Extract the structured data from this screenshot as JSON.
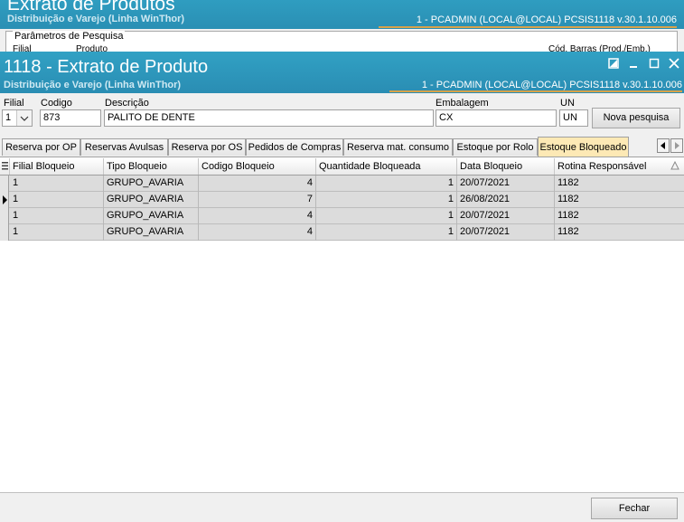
{
  "background_window": {
    "title": "Extrato de Produtos",
    "subtitle": "Distribuição e Varejo (Linha WinThor)",
    "session_info": "1 - PCADMIN (LOCAL@LOCAL)   PCSIS1118  v.30.1.10.006",
    "params_title": "Parâmetros de Pesquisa",
    "filial_label": "Filial",
    "produto_label": "Produto",
    "codbarras_label": "Cód. Barras (Prod./Emb.)"
  },
  "window": {
    "title": "1118 - Extrato de Produto",
    "subtitle": "Distribuição e Varejo (Linha WinThor)",
    "session_info": "1 - PCADMIN (LOCAL@LOCAL)   PCSIS1118  v.30.1.10.006",
    "controls": [
      "restore",
      "minimize",
      "maximize",
      "close"
    ]
  },
  "form": {
    "filial": {
      "label": "Filial",
      "value": "1"
    },
    "codigo": {
      "label": "Codigo",
      "value": "873"
    },
    "descricao": {
      "label": "Descrição",
      "value": "PALITO DE DENTE"
    },
    "embalagem": {
      "label": "Embalagem",
      "value": "CX"
    },
    "un": {
      "label": "UN",
      "value": "UN"
    },
    "nova_pesquisa": "Nova pesquisa"
  },
  "tabs": [
    {
      "label": "Reserva por OP",
      "active": false
    },
    {
      "label": "Reservas Avulsas",
      "active": false
    },
    {
      "label": "Reserva por OS",
      "active": false
    },
    {
      "label": "Pedidos de Compras",
      "active": false
    },
    {
      "label": "Reserva mat. consumo",
      "active": false
    },
    {
      "label": "Estoque por Rolo",
      "active": false
    },
    {
      "label": "Estoque Bloqueado",
      "active": true
    }
  ],
  "grid": {
    "columns": [
      "Filial Bloqueio",
      "Tipo Bloqueio",
      "Codigo Bloqueio",
      "Quantidade Bloqueada",
      "Data Bloqueio",
      "Rotina Responsável"
    ],
    "rows": [
      [
        "1",
        "GRUPO_AVARIA",
        "4",
        "1",
        "20/07/2021",
        "1182"
      ],
      [
        "1",
        "GRUPO_AVARIA",
        "7",
        "1",
        "26/08/2021",
        "1182"
      ],
      [
        "1",
        "GRUPO_AVARIA",
        "4",
        "1",
        "20/07/2021",
        "1182"
      ],
      [
        "1",
        "GRUPO_AVARIA",
        "4",
        "1",
        "20/07/2021",
        "1182"
      ]
    ],
    "current_row": 1
  },
  "footer": {
    "fechar": "Fechar"
  },
  "colors": {
    "header_blue": "#2a8fb4",
    "accent_gold": "#d7a24a",
    "active_tab": "#fde9b5",
    "row_gray": "#dcdcdc"
  }
}
